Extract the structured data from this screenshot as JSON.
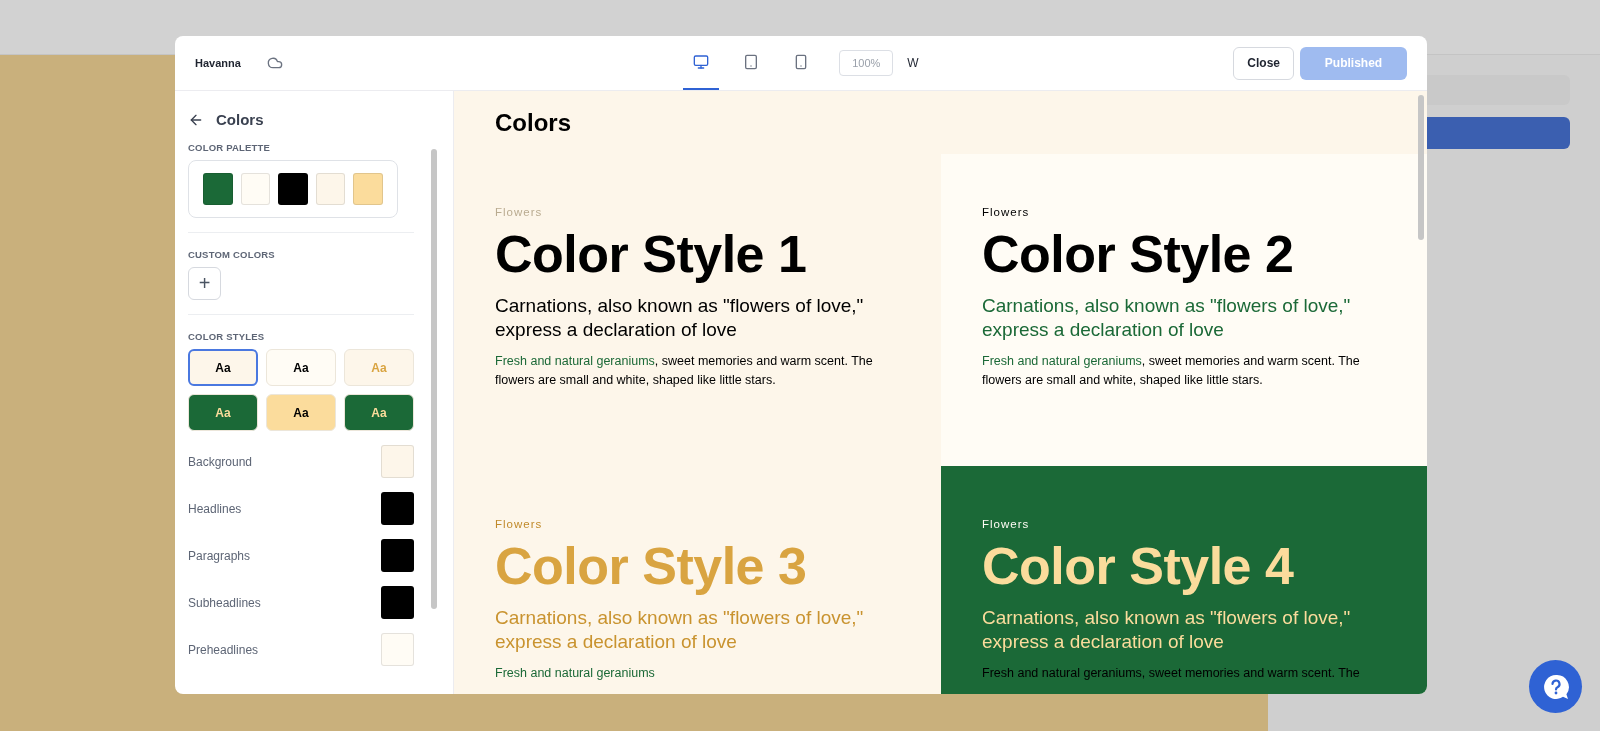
{
  "modal": {
    "title": "Havanna",
    "devices": [
      {
        "kind": "desktop",
        "selected": true
      },
      {
        "kind": "tablet",
        "selected": false
      },
      {
        "kind": "phone",
        "selected": false
      }
    ],
    "zoom": {
      "placeholder": "100%"
    },
    "width_label": "W",
    "close_button": "Close",
    "publish_button": {
      "label": "Published",
      "disabled": true
    }
  },
  "sidebar": {
    "title": "Colors",
    "palette_heading": "COLOR PALETTE",
    "palette": [
      {
        "color": "#1b6937"
      },
      {
        "color": "#fffcf5"
      },
      {
        "color": "#000000"
      },
      {
        "color": "#fdf6ea"
      },
      {
        "color": "#fbdc9c"
      }
    ],
    "custom_heading": "CUSTOM COLORS",
    "add_button": "+",
    "styles_heading": "COLOR STYLES",
    "styles": [
      {
        "label": "Aa",
        "kind": "cream",
        "selected": true
      },
      {
        "label": "Aa",
        "kind": "white",
        "selected": false
      },
      {
        "label": "Aa",
        "kind": "pale",
        "selected": false
      },
      {
        "label": "Aa",
        "kind": "green",
        "selected": false
      },
      {
        "label": "Aa",
        "kind": "gold",
        "selected": false
      },
      {
        "label": "Aa",
        "kind": "green",
        "selected": false
      }
    ],
    "roles": [
      {
        "label": "Background",
        "color": "#fdf6ea"
      },
      {
        "label": "Headlines",
        "color": "#000000"
      },
      {
        "label": "Paragraphs",
        "color": "#000000"
      },
      {
        "label": "Subheadlines",
        "color": "#000000"
      },
      {
        "label": "Preheadlines",
        "color": "#fffcf5"
      }
    ]
  },
  "preview": {
    "title": "Colors",
    "cards": [
      {
        "kind": "cream",
        "preheadline": "Flowers",
        "headline": "Color Style 1",
        "subheadline": "Carnations, also known as \"flowers of love,\" express a declaration of love",
        "link": "Fresh and natural geraniums",
        "paragraph": ", sweet memories and warm scent. The flowers are small and white, shaped like little stars."
      },
      {
        "kind": "white",
        "preheadline": "Flowers",
        "headline": "Color Style 2",
        "subheadline": "Carnations, also known as \"flowers of love,\" express a declaration of love",
        "link": "Fresh and natural geraniums",
        "paragraph": ", sweet memories and warm scent. The flowers are small and white, shaped like little stars."
      },
      {
        "kind": "pale",
        "preheadline": "Flowers",
        "headline": "Color Style 3",
        "subheadline": "Carnations, also known as \"flowers of love,\" express a declaration of love",
        "link": "Fresh and natural geraniums"
      },
      {
        "kind": "green",
        "preheadline": "Flowers",
        "headline": "Color Style 4",
        "subheadline": "Carnations, also known as \"flowers of love,\" express a declaration of love",
        "link": "Fresh and natural geraniums",
        "paragraph": ", sweet memories and warm scent. The"
      }
    ]
  }
}
